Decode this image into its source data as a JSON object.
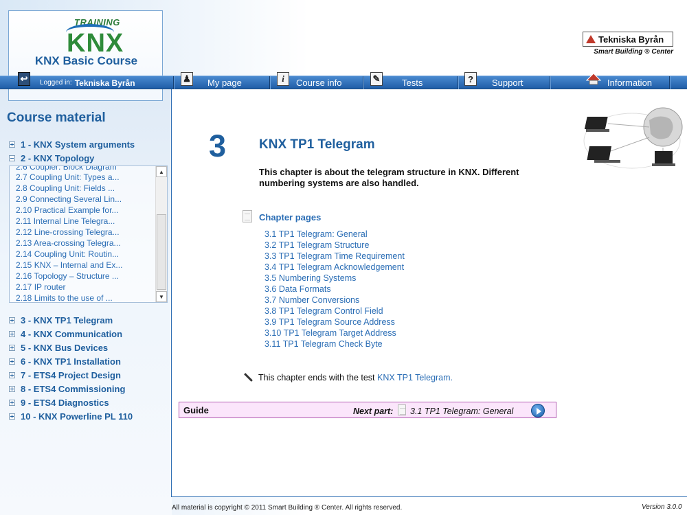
{
  "logo": {
    "training": "TRAINING",
    "knx": "KNX",
    "course_title": "KNX Basic Course"
  },
  "brand": {
    "name": "Tekniska Byrån",
    "subtitle": "Smart Building ® Center"
  },
  "nav": {
    "logged_in_label": "Logged in:",
    "logged_in_name": "Tekniska Byrån",
    "items": [
      {
        "label": "My page",
        "icon": "person-icon"
      },
      {
        "label": "Course info",
        "icon": "info-icon"
      },
      {
        "label": "Tests",
        "icon": "pen-icon"
      },
      {
        "label": "Support",
        "icon": "question-icon"
      },
      {
        "label": "Information",
        "icon": "house-icon"
      }
    ]
  },
  "sidebar": {
    "title": "Course material",
    "chapters_top": [
      {
        "label": "1 - KNX System arguments",
        "expanded": false
      },
      {
        "label": "2 - KNX Topology",
        "expanded": true
      }
    ],
    "subitems": [
      "2.6  Coupler: Block Diagram",
      "2.7  Coupling Unit: Types a...",
      "2.8  Coupling Unit: Fields ...",
      "2.9  Connecting Several Lin...",
      "2.10  Practical Example for...",
      "2.11  Internal Line Telegra...",
      "2.12  Line-crossing Telegra...",
      "2.13  Area-crossing Telegra...",
      "2.14  Coupling Unit: Routin...",
      "2.15  KNX – Internal and Ex...",
      "2.16  Topology – Structure ...",
      "2.17  IP router",
      "2.18  Limits to the use of ..."
    ],
    "chapters_bottom": [
      "3 - KNX TP1 Telegram",
      "4 - KNX Communication",
      "5 - KNX Bus Devices",
      "6 - KNX TP1 Installation",
      "7 - ETS4 Project Design",
      "8 - ETS4 Commissioning",
      "9 - ETS4 Diagnostics",
      "10 - KNX Powerline PL 110"
    ]
  },
  "main": {
    "chapter_number": "3",
    "chapter_title": "KNX TP1 Telegram",
    "description": "This chapter is about the telegram structure in KNX. Different numbering systems are also handled.",
    "pages_heading": "Chapter pages",
    "pages": [
      "3.1  TP1 Telegram: General",
      "3.2  TP1 Telegram Structure",
      "3.3  TP1 Telegram Time Requirement",
      "3.4  TP1 Telegram Acknowledgement",
      "3.5  Numbering Systems",
      "3.6  Data Formats",
      "3.7  Number Conversions",
      "3.8  TP1 Telegram Control Field",
      "3.9  TP1 Telegram Source Address",
      "3.10  TP1 Telegram Target Address",
      "3.11  TP1 Telegram Check Byte"
    ],
    "test_text": "This chapter ends with the test",
    "test_link": "KNX TP1 Telegram."
  },
  "guide": {
    "label": "Guide",
    "next_label": "Next part:",
    "next_link": "3.1 TP1 Telegram: General"
  },
  "footer": {
    "copyright": "All material is copyright © 2011 Smart Building ® Center. All rights reserved.",
    "version": "Version 3.0.0"
  },
  "colors": {
    "accent": "#1f5f9e",
    "link": "#2a6db5",
    "nav": "#2b6bb5",
    "guide_bg": "#fbe6fb"
  }
}
